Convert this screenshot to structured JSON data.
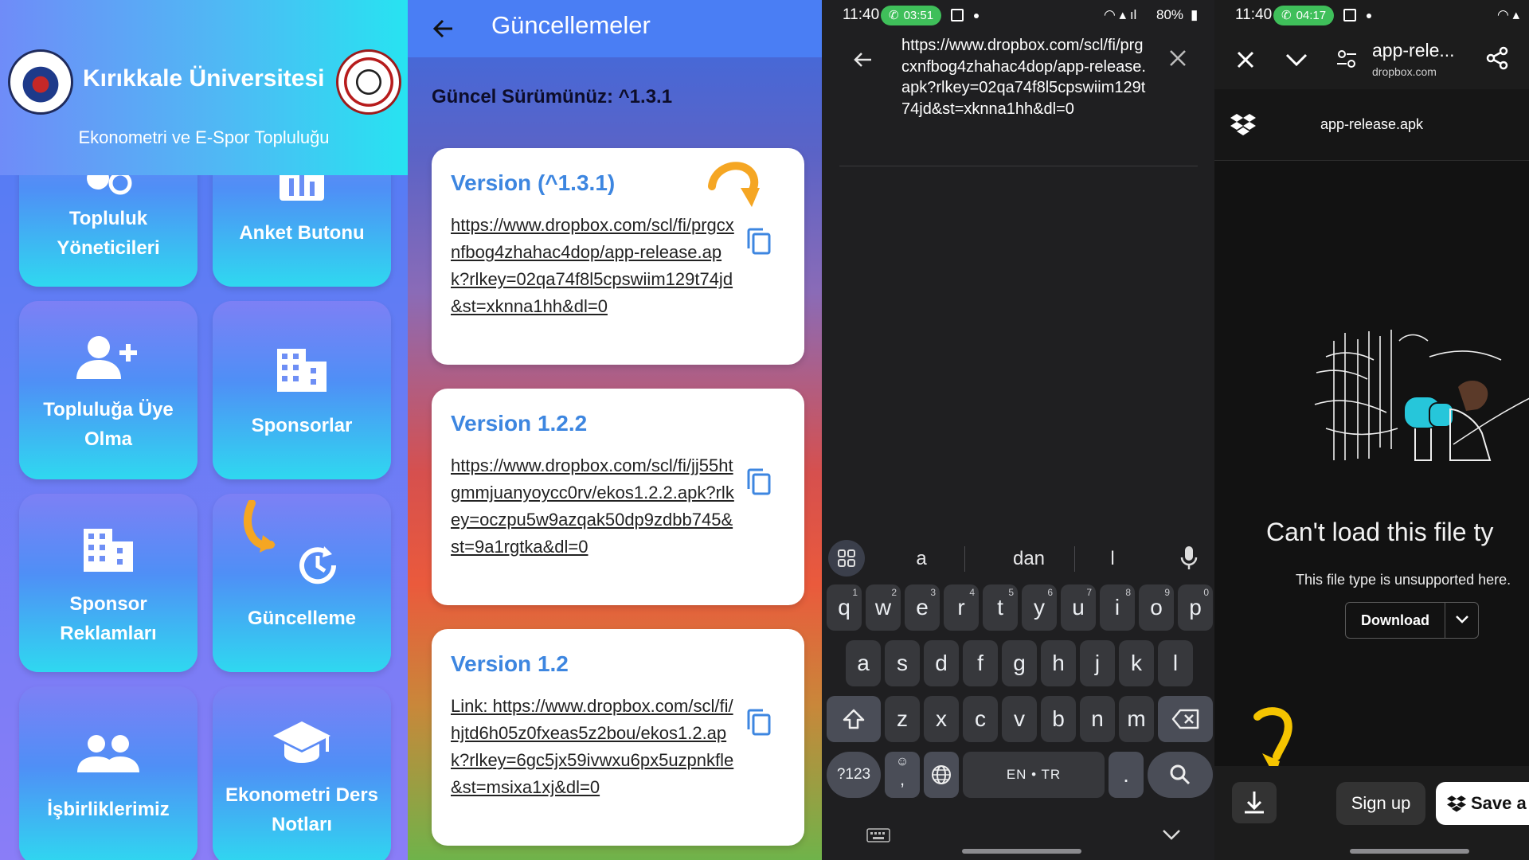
{
  "panel1": {
    "title": "Kırıkkale Üniversitesi",
    "subtitle": "Ekonometri ve E-Spor Topluluğu",
    "tiles": [
      {
        "label": "Topluluk Yöneticileri",
        "icon": "people-circle-icon"
      },
      {
        "label": "Anket Butonu",
        "icon": "poll-icon"
      },
      {
        "label": "Topluluğa Üye Olma",
        "icon": "person-add-icon"
      },
      {
        "label": "Sponsorlar",
        "icon": "building-icon"
      },
      {
        "label": "Sponsor Reklamları",
        "icon": "building-icon"
      },
      {
        "label": "Güncelleme",
        "icon": "update-icon"
      },
      {
        "label": "İşbirliklerimiz",
        "icon": "group-icon"
      },
      {
        "label": "Ekonometri Ders Notları",
        "icon": "school-icon"
      }
    ]
  },
  "panel2": {
    "title": "Güncellemeler",
    "current_version": "Güncel Sürümünüz: ^1.3.1",
    "versions": [
      {
        "title": "Version (^1.3.1)",
        "link": "https://www.dropbox.com/scl/fi/prgcxnfbog4zhahac4dop/app-release.apk?rlkey=02qa74f8l5cpswiim129t74jd&st=xknna1hh&dl=0"
      },
      {
        "title": "Version 1.2.2",
        "link": "https://www.dropbox.com/scl/fi/jj55htgmmjuanyoycc0rv/ekos1.2.2.apk?rlkey=oczpu5w9azqak50dp9zdbb745&st=9a1rgtka&dl=0"
      },
      {
        "title": "Version 1.2",
        "link": "Link: https://www.dropbox.com/scl/fi/hjtd6h05z0fxeas5z2bou/ekos1.2.apk?rlkey=6gc5jx59ivwxu6px5uzpnkfle&st=msixa1xj&dl=0"
      }
    ]
  },
  "panel3": {
    "status": {
      "time": "11:40",
      "call": "03:51",
      "battery": "80%"
    },
    "url": "https://www.dropbox.com/scl/fi/prgcxnfbog4zhahac4dop/app-release.apk?rlkey=02qa74f8l5cpswiim129t74jd&st=xknna1hh&dl=0",
    "keyboard": {
      "suggestions": [
        "a",
        "dan",
        "l"
      ],
      "row1": [
        "q",
        "w",
        "e",
        "r",
        "t",
        "y",
        "u",
        "i",
        "o",
        "p"
      ],
      "row1_hints": [
        "1",
        "2",
        "3",
        "4",
        "5",
        "6",
        "7",
        "8",
        "9",
        "0"
      ],
      "row2": [
        "a",
        "s",
        "d",
        "f",
        "g",
        "h",
        "j",
        "k",
        "l"
      ],
      "row3": [
        "z",
        "x",
        "c",
        "v",
        "b",
        "n",
        "m"
      ],
      "numbers_key": "?123",
      "emoji_key": ",",
      "space_label": "EN • TR",
      "period_key": "."
    }
  },
  "panel4": {
    "status": {
      "time": "11:40",
      "call": "04:17"
    },
    "tab_title": "app-rele...",
    "domain": "dropbox.com",
    "file_name": "app-release.apk",
    "error_title": "Can't load this file ty",
    "error_body": "This file type is unsupported here.",
    "download_label": "Download",
    "sign_up_label": "Sign up",
    "save_label": "Save a"
  }
}
